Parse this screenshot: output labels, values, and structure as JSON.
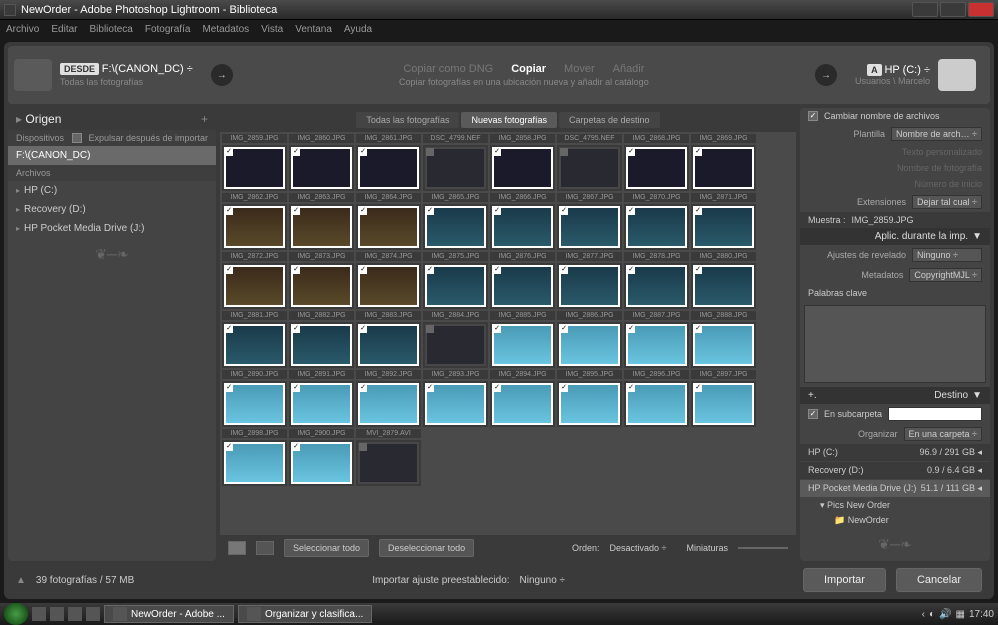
{
  "window": {
    "title": "NewOrder - Adobe Photoshop Lightroom - Biblioteca"
  },
  "menu": [
    "Archivo",
    "Editar",
    "Biblioteca",
    "Fotografía",
    "Metadatos",
    "Vista",
    "Ventana",
    "Ayuda"
  ],
  "top": {
    "from_tag": "DESDE",
    "from_path": "F:\\(CANON_DC) ÷",
    "from_sub": "Todas las fotografías",
    "opts": [
      {
        "l": "Copiar como DNG",
        "a": false
      },
      {
        "l": "Copiar",
        "a": true
      },
      {
        "l": "Mover",
        "a": false
      },
      {
        "l": "Añadir",
        "a": false
      }
    ],
    "subtitle": "Copiar fotografías en una ubicación nueva y añadir al catálogo",
    "to_tag": "A",
    "to_path": "HP (C:) ÷",
    "to_sub": "Usuarios \\ Marcelo"
  },
  "left": {
    "head": "Origen",
    "devices": "Dispositivos",
    "eject": "Expulsar después de importar",
    "src": "F:\\(CANON_DC)",
    "archives": "Archivos",
    "drives": [
      "HP (C:)",
      "Recovery (D:)",
      "HP Pocket Media Drive (J:)"
    ]
  },
  "tabs": [
    {
      "l": "Todas las fotografías",
      "a": false
    },
    {
      "l": "Nuevas fotografías",
      "a": true
    },
    {
      "l": "Carpetas de destino",
      "a": false
    }
  ],
  "thumbs": [
    [
      {
        "f": "IMG_2859.JPG",
        "c": "dark",
        "k": 1
      },
      {
        "f": "IMG_2860.JPG",
        "c": "dark",
        "k": 1
      },
      {
        "f": "IMG_2861.JPG",
        "c": "dark",
        "k": 1
      },
      {
        "f": "DSC_4799.NEF",
        "c": "dark",
        "k": 0,
        "d": 1
      },
      {
        "f": "IMG_2858.JPG",
        "c": "dark",
        "k": 1
      },
      {
        "f": "DSC_4795.NEF",
        "c": "dark",
        "k": 0,
        "d": 1
      },
      {
        "f": "IMG_2868.JPG",
        "c": "dark",
        "k": 1
      },
      {
        "f": "IMG_2869.JPG",
        "c": "dark",
        "k": 1
      }
    ],
    [
      {
        "f": "IMG_2862.JPG",
        "c": "group",
        "k": 1
      },
      {
        "f": "IMG_2863.JPG",
        "c": "group",
        "k": 1
      },
      {
        "f": "IMG_2864.JPG",
        "c": "group",
        "k": 1
      },
      {
        "f": "IMG_2865.JPG",
        "c": "pool-d",
        "k": 1
      },
      {
        "f": "IMG_2866.JPG",
        "c": "pool-d",
        "k": 1
      },
      {
        "f": "IMG_2867.JPG",
        "c": "pool-d",
        "k": 1
      },
      {
        "f": "IMG_2870.JPG",
        "c": "pool-d",
        "k": 1
      },
      {
        "f": "IMG_2871.JPG",
        "c": "pool-d",
        "k": 1
      }
    ],
    [
      {
        "f": "IMG_2872.JPG",
        "c": "group",
        "k": 1
      },
      {
        "f": "IMG_2873.JPG",
        "c": "group",
        "k": 1
      },
      {
        "f": "IMG_2874.JPG",
        "c": "group",
        "k": 1
      },
      {
        "f": "IMG_2875.JPG",
        "c": "pool-d",
        "k": 1
      },
      {
        "f": "IMG_2876.JPG",
        "c": "pool-d",
        "k": 1
      },
      {
        "f": "IMG_2877.JPG",
        "c": "pool-d",
        "k": 1
      },
      {
        "f": "IMG_2878.JPG",
        "c": "pool-d",
        "k": 1
      },
      {
        "f": "IMG_2880.JPG",
        "c": "pool-d",
        "k": 1
      }
    ],
    [
      {
        "f": "IMG_2881.JPG",
        "c": "pool-d",
        "k": 1
      },
      {
        "f": "IMG_2882.JPG",
        "c": "pool-d",
        "k": 1
      },
      {
        "f": "IMG_2883.JPG",
        "c": "pool-d",
        "k": 1
      },
      {
        "f": "IMG_2884.JPG",
        "c": "dark",
        "k": 0,
        "d": 1
      },
      {
        "f": "IMG_2885.JPG",
        "c": "pool-l",
        "k": 1
      },
      {
        "f": "IMG_2886.JPG",
        "c": "pool-l",
        "k": 1
      },
      {
        "f": "IMG_2887.JPG",
        "c": "pool-l",
        "k": 1
      },
      {
        "f": "IMG_2888.JPG",
        "c": "pool-l",
        "k": 1
      }
    ],
    [
      {
        "f": "IMG_2890.JPG",
        "c": "pool-l",
        "k": 1
      },
      {
        "f": "IMG_2891.JPG",
        "c": "pool-l",
        "k": 1
      },
      {
        "f": "IMG_2892.JPG",
        "c": "pool-l",
        "k": 1
      },
      {
        "f": "IMG_2893.JPG",
        "c": "pool-l",
        "k": 1
      },
      {
        "f": "IMG_2894.JPG",
        "c": "pool-l",
        "k": 1
      },
      {
        "f": "IMG_2895.JPG",
        "c": "pool-l",
        "k": 1
      },
      {
        "f": "IMG_2896.JPG",
        "c": "pool-l",
        "k": 1
      },
      {
        "f": "IMG_2897.JPG",
        "c": "pool-l",
        "k": 1
      }
    ],
    [
      {
        "f": "IMG_2898.JPG",
        "c": "pool-l",
        "k": 1
      },
      {
        "f": "IMG_2900.JPG",
        "c": "pool-l",
        "k": 1
      },
      {
        "f": "MVI_2879.AVI",
        "c": "dark",
        "k": 0,
        "d": 1
      }
    ]
  ],
  "toolbar": {
    "btn1": "Seleccionar todo",
    "btn2": "Deseleccionar todo",
    "sort_l": "Orden:",
    "sort_v": "Desactivado ÷",
    "thumb_l": "Miniaturas"
  },
  "right": {
    "rename": {
      "chk": "Cambiar nombre de archivos",
      "tpl_l": "Plantilla",
      "tpl_v": "Nombre de arch… ÷",
      "txt": "Texto personalizado",
      "name": "Nombre de fotografía",
      "num": "Número de inicio",
      "ext_l": "Extensiones",
      "ext_v": "Dejar tal cual ÷",
      "sample_l": "Muestra :",
      "sample_v": "IMG_2859.JPG"
    },
    "apply": {
      "head": "Aplic. durante la imp.",
      "dev_l": "Ajustes de revelado",
      "dev_v": "Ninguno ÷",
      "meta_l": "Metadatos",
      "meta_v": "CopyrightMJL ÷",
      "keys": "Palabras clave"
    },
    "dest": {
      "head": "Destino",
      "sub_l": "En subcarpeta",
      "org_l": "Organizar",
      "org_v": "En una carpeta ÷",
      "drives": [
        {
          "n": "HP (C:)",
          "s": "96.9 / 291 GB"
        },
        {
          "n": "Recovery (D:)",
          "s": "0.9 / 6.4 GB"
        },
        {
          "n": "HP Pocket Media Drive (J:)",
          "s": "51.1 / 111 GB"
        }
      ],
      "folder": "Pics New Order",
      "subfolder": "NewOrder"
    }
  },
  "status": {
    "count": "39 fotografías / 57 MB",
    "preset_l": "Importar ajuste preestablecido:",
    "preset_v": "Ninguno ÷",
    "import": "Importar",
    "cancel": "Cancelar"
  },
  "taskbar": {
    "t1": "NewOrder - Adobe ...",
    "t2": "Organizar y clasifica...",
    "time": "17:40"
  }
}
